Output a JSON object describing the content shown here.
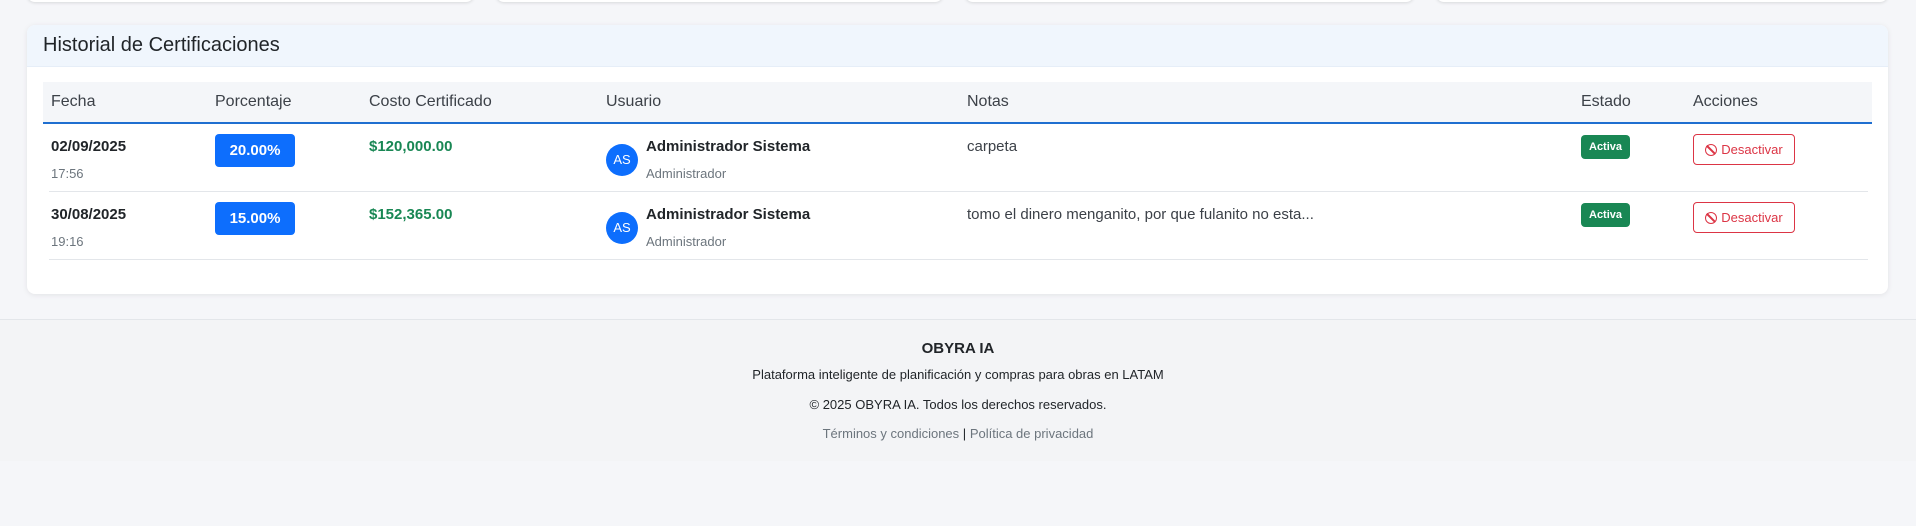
{
  "history": {
    "title": "Historial de Certificaciones",
    "columns": {
      "fecha": "Fecha",
      "porcentaje": "Porcentaje",
      "costo": "Costo Certificado",
      "usuario": "Usuario",
      "notas": "Notas",
      "estado": "Estado",
      "acciones": "Acciones"
    },
    "rows": [
      {
        "date": "02/09/2025",
        "time": "17:56",
        "percent": "20.00%",
        "cost": "$120,000.00",
        "avatar": "AS",
        "user_name": "Administrador Sistema",
        "user_role": "Administrador",
        "notes": "carpeta",
        "status": "Activa",
        "action": "Desactivar"
      },
      {
        "date": "30/08/2025",
        "time": "19:16",
        "percent": "15.00%",
        "cost": "$152,365.00",
        "avatar": "AS",
        "user_name": "Administrador Sistema",
        "user_role": "Administrador",
        "notes": "tomo el dinero menganito, por que fulanito no esta...",
        "status": "Activa",
        "action": "Desactivar"
      }
    ]
  },
  "footer": {
    "brand": "OBYRA IA",
    "tagline": "Plataforma inteligente de planificación y compras para obras en LATAM",
    "copyright": "© 2025 OBYRA IA. Todos los derechos reservados.",
    "terms": "Términos y condiciones",
    "separator": "|",
    "privacy": "Política de privacidad"
  },
  "colors": {
    "primary": "#0d6efd",
    "success": "#198754",
    "danger": "#dc3545",
    "header_bg": "#f0f6fd"
  },
  "icons": {
    "deactivate": "ban-icon"
  }
}
